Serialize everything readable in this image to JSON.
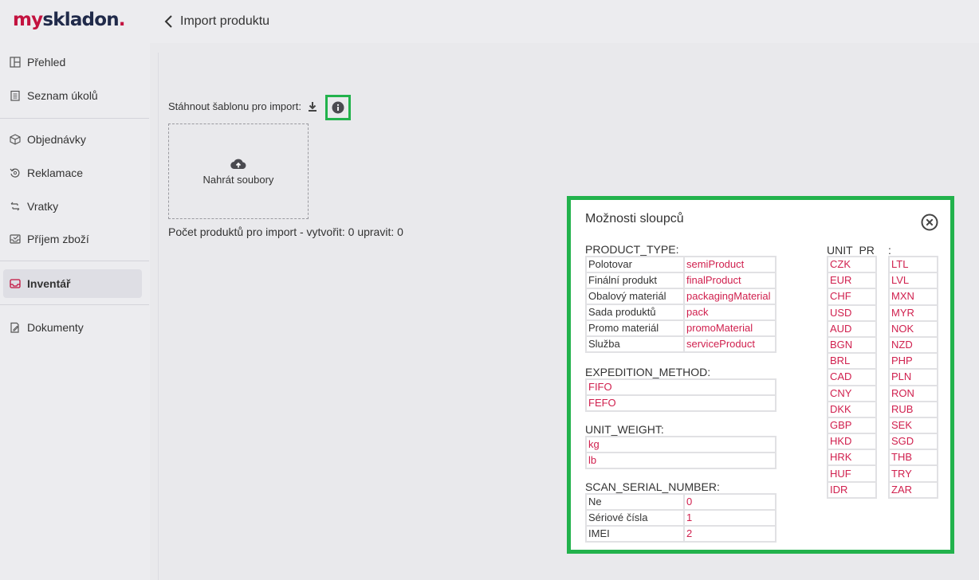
{
  "app": {
    "logo_my": "my",
    "logo_rest": "skladon",
    "logo_dot": ".",
    "page_title": "Import produktu"
  },
  "sidebar": {
    "items": [
      {
        "label": "Přehled",
        "icon": "grid-icon"
      },
      {
        "label": "Seznam úkolů",
        "icon": "clipboard-icon"
      },
      {
        "label": "Objednávky",
        "icon": "box-icon"
      },
      {
        "label": "Reklamace",
        "icon": "return-circle-icon"
      },
      {
        "label": "Vratky",
        "icon": "swap-icon"
      },
      {
        "label": "Příjem zboží",
        "icon": "inbox-tray-icon"
      },
      {
        "label": "Inventář",
        "icon": "inventory-tray-icon",
        "active": true
      },
      {
        "label": "Dokumenty",
        "icon": "document-edit-icon"
      }
    ]
  },
  "main": {
    "download_label": "Stáhnout šablonu pro import:",
    "upload_label": "Nahrát soubory",
    "count_text": "Počet produktů pro import - vytvořit: 0 upravit: 0"
  },
  "modal": {
    "title": "Možnosti sloupců",
    "product_type": {
      "label": "PRODUCT_TYPE:",
      "rows": [
        {
          "name": "Polotovar",
          "value": "semiProduct"
        },
        {
          "name": "Finální produkt",
          "value": "finalProduct"
        },
        {
          "name": "Obalový materiál",
          "value": "packagingMaterial"
        },
        {
          "name": "Sada produktů",
          "value": "pack"
        },
        {
          "name": "Promo materiál",
          "value": "promoMaterial"
        },
        {
          "name": "Služba",
          "value": "serviceProduct"
        }
      ]
    },
    "expedition_method": {
      "label": "EXPEDITION_METHOD:",
      "rows": [
        "FIFO",
        "FEFO"
      ]
    },
    "unit_weight": {
      "label": "UNIT_WEIGHT:",
      "rows": [
        "kg",
        "lb"
      ]
    },
    "scan_serial_number": {
      "label": "SCAN_SERIAL_NUMBER:",
      "rows": [
        {
          "name": "Ne",
          "value": "0"
        },
        {
          "name": "Sériové čísla",
          "value": "1"
        },
        {
          "name": "IMEI",
          "value": "2"
        }
      ]
    },
    "unit_price": {
      "label_left": "UNIT_PR",
      "label_right": ":",
      "col1": [
        "CZK",
        "EUR",
        "CHF",
        "USD",
        "AUD",
        "BGN",
        "BRL",
        "CAD",
        "CNY",
        "DKK",
        "GBP",
        "HKD",
        "HRK",
        "HUF",
        "IDR"
      ],
      "col2": [
        "LTL",
        "LVL",
        "MXN",
        "MYR",
        "NOK",
        "NZD",
        "PHP",
        "PLN",
        "RON",
        "RUB",
        "SEK",
        "SGD",
        "THB",
        "TRY",
        "ZAR"
      ]
    }
  },
  "colors": {
    "accent": "#c3123f",
    "value_text": "#d0204e",
    "highlight_border": "#22b24c",
    "navy": "#202a4a"
  }
}
